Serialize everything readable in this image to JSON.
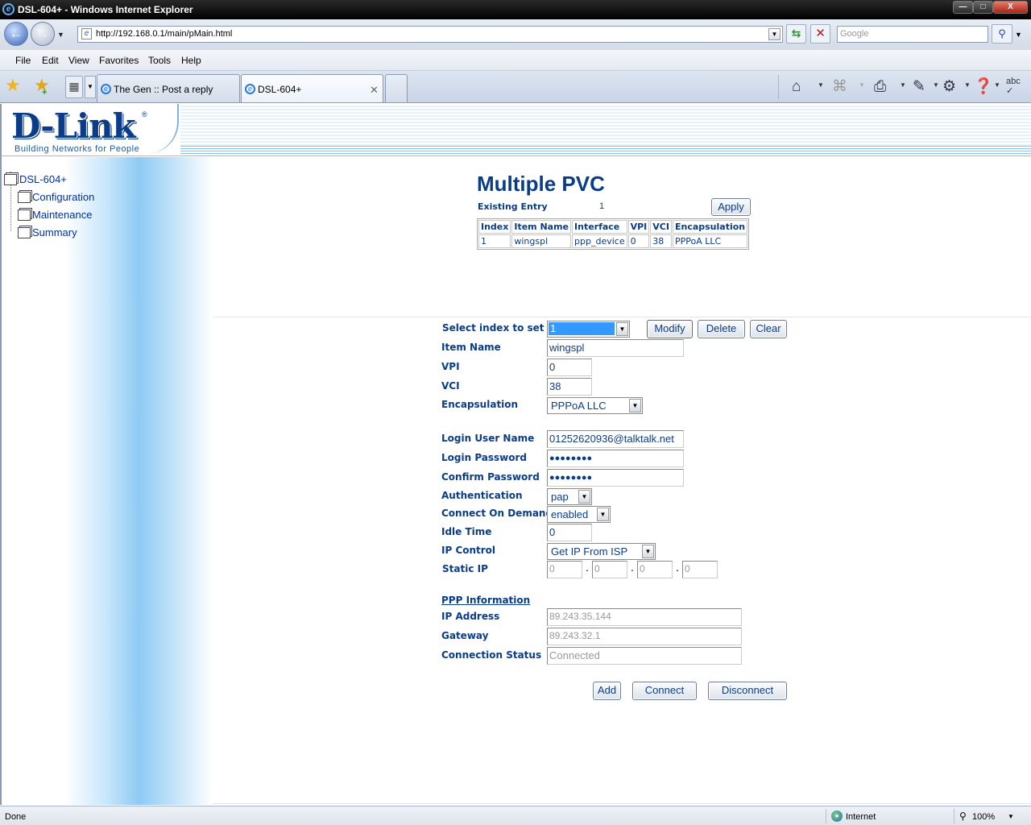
{
  "window": {
    "title": "DSL-604+ - Windows Internet Explorer",
    "min": "—",
    "max": "□",
    "close": "X"
  },
  "address": {
    "url": "http://192.168.0.1/main/pMain.html",
    "search_placeholder": "Google"
  },
  "menu": [
    "File",
    "Edit",
    "View",
    "Favorites",
    "Tools",
    "Help"
  ],
  "tabs": [
    {
      "label": "The Gen :: Post a reply"
    },
    {
      "label": "DSL-604+"
    }
  ],
  "toolbar_icons": [
    "home-icon",
    "feeds-icon",
    "print-icon",
    "page-icon",
    "tools-icon",
    "help-icon",
    "spelling-icon"
  ],
  "colors": {
    "brand": "#0a3c8a",
    "link": "#0030a0"
  },
  "brand": {
    "logo": "D-Link",
    "reg": "®",
    "tagline": "Building Networks for People"
  },
  "sidebar": {
    "root": "DSL-604+",
    "items": [
      "Configuration",
      "Maintenance",
      "Summary"
    ]
  },
  "pvc": {
    "title": "Multiple PVC",
    "existing_entry_label": "Existing Entry",
    "existing_entry_value": "1",
    "apply_label": "Apply",
    "columns": [
      "Index",
      "Item Name",
      "Interface",
      "VPI",
      "VCI",
      "Encapsulation"
    ],
    "rows": [
      [
        "1",
        "wingspl",
        "ppp_device",
        "0",
        "38",
        "PPPoA LLC"
      ]
    ]
  },
  "form": {
    "select_index_label": "Select index to set",
    "select_index_value": "1",
    "modify_label": "Modify",
    "delete_label": "Delete",
    "clear_label": "Clear",
    "item_name_label": "Item Name",
    "item_name_value": "wingspl",
    "vpi_label": "VPI",
    "vpi_value": "0",
    "vci_label": "VCI",
    "vci_value": "38",
    "encapsulation_label": "Encapsulation",
    "encapsulation_value": "PPPoA LLC",
    "login_user_label": "Login User Name",
    "login_user_value": "01252620936@talktalk.net",
    "login_password_label": "Login Password",
    "login_password_value": "●●●●●●●●",
    "confirm_password_label": "Confirm Password",
    "confirm_password_value": "●●●●●●●●",
    "authentication_label": "Authentication",
    "authentication_value": "pap",
    "connect_on_demand_label": "Connect On Demand",
    "connect_on_demand_value": "enabled",
    "idle_time_label": "Idle Time",
    "idle_time_value": "0",
    "ip_control_label": "IP Control",
    "ip_control_value": "Get IP From ISP",
    "static_ip_label": "Static IP",
    "static_ip": [
      "0",
      "0",
      "0",
      "0"
    ]
  },
  "ppp": {
    "heading": "PPP Information",
    "ip_address_label": "IP Address",
    "ip_address_value": "89.243.35.144",
    "gateway_label": "Gateway",
    "gateway_value": "89.243.32.1",
    "status_label": "Connection Status",
    "status_value": "Connected",
    "add_label": "Add",
    "connect_label": "Connect",
    "disconnect_label": "Disconnect"
  },
  "statusbar": {
    "status": "Done",
    "zone": "Internet",
    "zoom": "100%"
  }
}
